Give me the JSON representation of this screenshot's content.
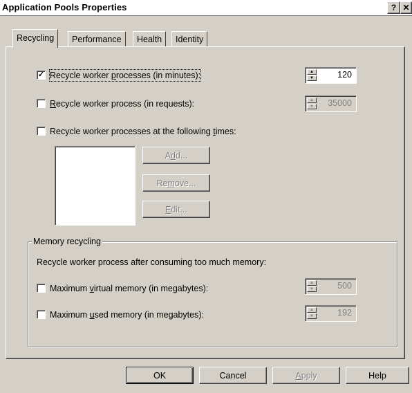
{
  "window": {
    "title": "Application Pools Properties",
    "help_glyph": "?",
    "close_glyph": "✕"
  },
  "tabs": [
    {
      "label": "Recycling",
      "active": true
    },
    {
      "label": "Performance",
      "active": false
    },
    {
      "label": "Health",
      "active": false
    },
    {
      "label": "Identity",
      "active": false
    }
  ],
  "recycling": {
    "minutes": {
      "label_pre": "Recycle worker ",
      "label_u": "p",
      "label_post": "rocesses (in minutes):",
      "checked": true,
      "value": "120"
    },
    "requests": {
      "label_pre": "",
      "label_u": "R",
      "label_post": "ecycle worker process (in requests):",
      "checked": false,
      "value": "35000"
    },
    "times": {
      "label_pre": "Recycle worker processes at the following ",
      "label_u": "t",
      "label_post": "imes:",
      "checked": false
    },
    "buttons": {
      "add": {
        "pre": "A",
        "u": "d",
        "post": "d..."
      },
      "remove": {
        "pre": "Re",
        "u": "m",
        "post": "ove..."
      },
      "edit": {
        "pre": "",
        "u": "E",
        "post": "dit..."
      }
    }
  },
  "memory": {
    "legend": "Memory recycling",
    "description": "Recycle worker process after consuming too much memory:",
    "virtual": {
      "label_pre": "Maximum ",
      "label_u": "v",
      "label_post": "irtual memory (in megabytes):",
      "checked": false,
      "value": "500"
    },
    "used": {
      "label_pre": "Maximum ",
      "label_u": "u",
      "label_post": "sed memory (in megabytes):",
      "checked": false,
      "value": "192"
    }
  },
  "footer": {
    "ok": "OK",
    "cancel": "Cancel",
    "apply": {
      "u": "A",
      "post": "pply"
    },
    "help": "Help"
  },
  "check_glyph": "✓"
}
